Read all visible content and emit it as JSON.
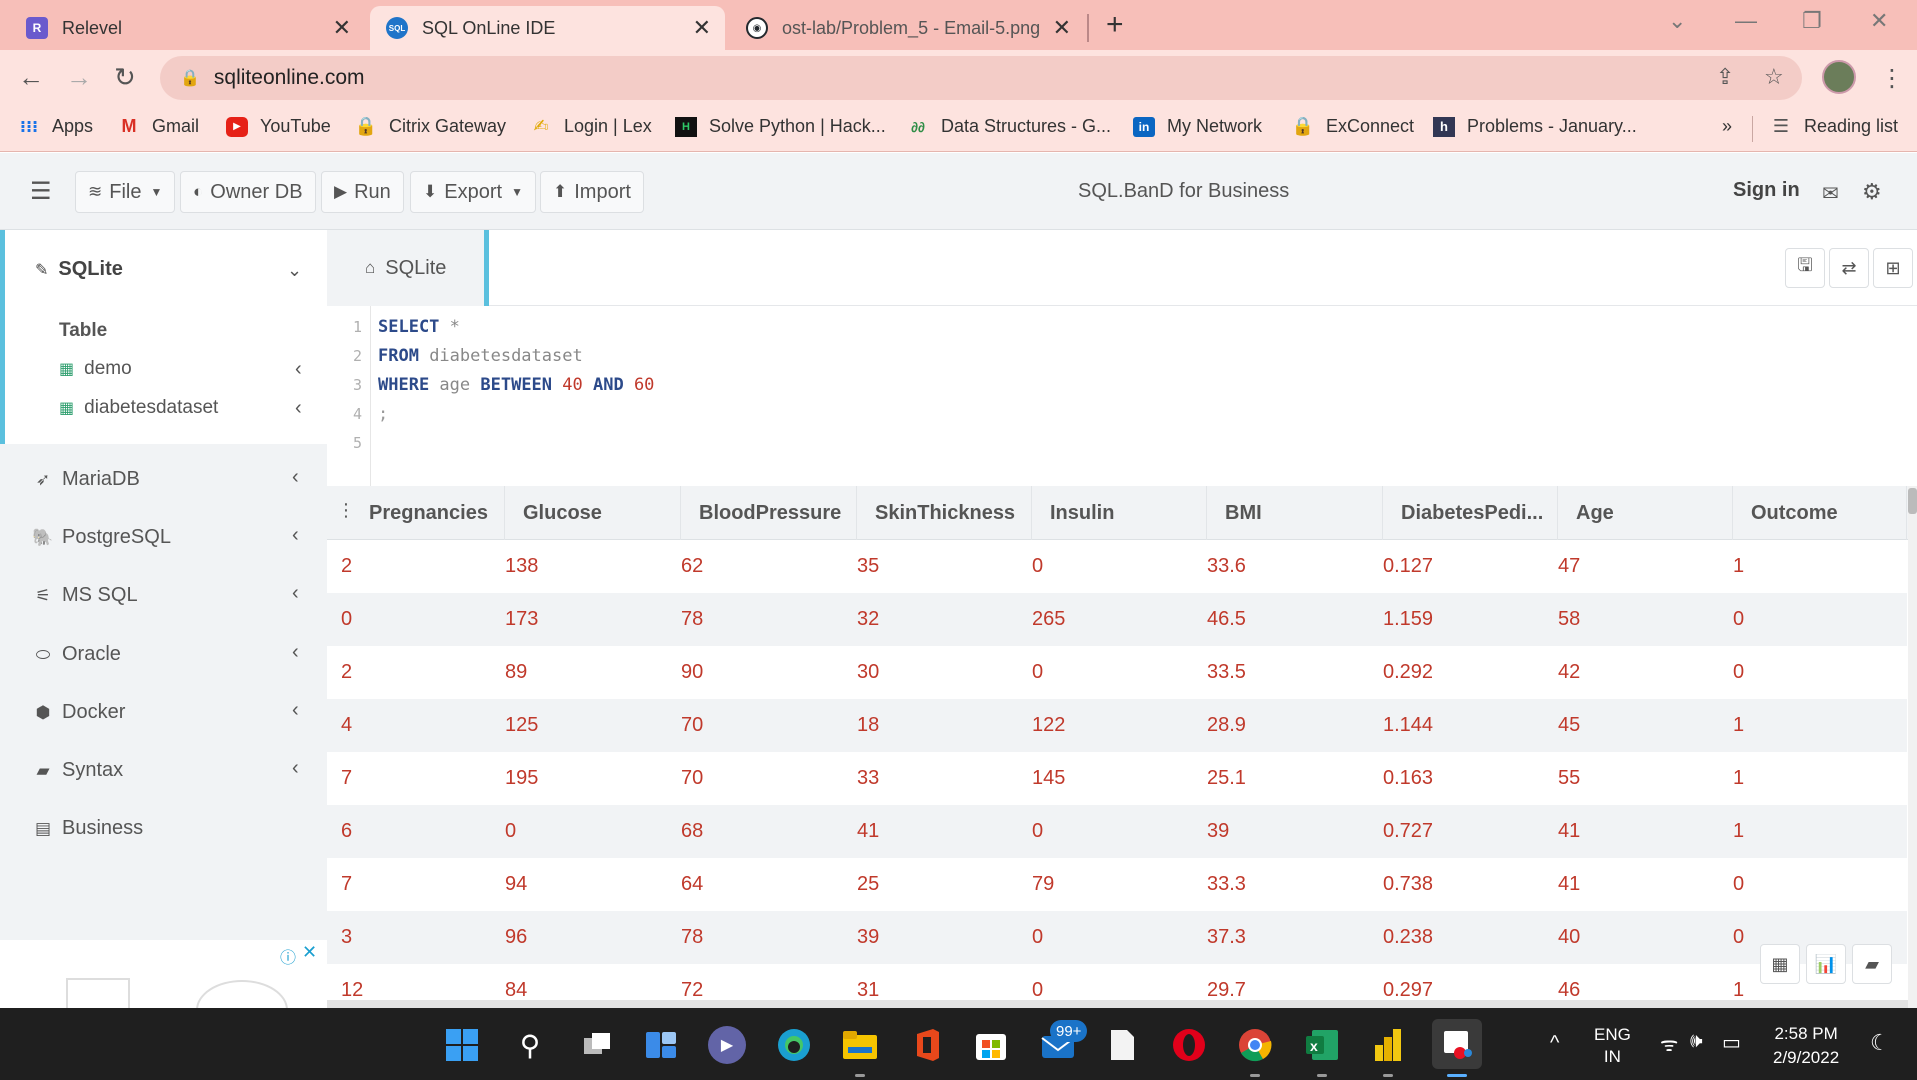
{
  "browser": {
    "tabs": [
      {
        "title": "Relevel",
        "icon": "relevel-icon",
        "color": "#6a5acd",
        "glyph": "R"
      },
      {
        "title": "SQL OnLine IDE",
        "icon": "sql-icon",
        "color": "#1f74c9",
        "glyph": "SQL"
      },
      {
        "title": "ost-lab/Problem_5 - Email-5.png",
        "icon": "github-icon",
        "color": "#24292e",
        "glyph": "◉"
      }
    ],
    "url": "sqliteonline.com",
    "bookmarks": [
      {
        "label": "Apps",
        "icon": "apps-grid-icon"
      },
      {
        "label": "Gmail",
        "icon": "gmail-icon"
      },
      {
        "label": "YouTube",
        "icon": "youtube-icon"
      },
      {
        "label": "Citrix Gateway",
        "icon": "citrix-icon"
      },
      {
        "label": "Login | Lex",
        "icon": "lex-icon"
      },
      {
        "label": "Solve Python | Hack...",
        "icon": "hackerrank-icon"
      },
      {
        "label": "Data Structures - G...",
        "icon": "geeks-icon"
      },
      {
        "label": "My Network",
        "icon": "linkedin-icon"
      },
      {
        "label": "ExConnect",
        "icon": "exconnect-icon"
      },
      {
        "label": "Problems - January...",
        "icon": "hackerearth-icon"
      }
    ],
    "reading_list": "Reading list",
    "more": "»"
  },
  "app": {
    "menu": {
      "file": "File",
      "owner_db": "Owner DB",
      "run": "Run",
      "export": "Export",
      "import": "Import"
    },
    "title": "SQL.BanD for Business",
    "sign_in": "Sign in"
  },
  "sidebar": {
    "sqlite": "SQLite",
    "table_heading": "Table",
    "tables": [
      "demo",
      "diabetesdataset"
    ],
    "databases": [
      {
        "label": "MariaDB",
        "icon": "mariadb-icon"
      },
      {
        "label": "PostgreSQL",
        "icon": "postgresql-icon"
      },
      {
        "label": "MS SQL",
        "icon": "mssql-icon"
      },
      {
        "label": "Oracle",
        "icon": "oracle-icon"
      },
      {
        "label": "Docker",
        "icon": "docker-icon"
      },
      {
        "label": "Syntax",
        "icon": "syntax-icon"
      },
      {
        "label": "Business",
        "icon": "business-icon"
      }
    ]
  },
  "editor": {
    "tab": "SQLite",
    "line_numbers": [
      "1",
      "2",
      "3",
      "4",
      "5"
    ],
    "code": {
      "l1_kw": "SELECT",
      "l1_rest": " *",
      "l2_kw": "FROM",
      "l2_id": " diabetesdataset",
      "l3_kw": "WHERE",
      "l3_id": " age ",
      "l3_kw2": "BETWEEN",
      "l3_n1": " 40 ",
      "l3_kw3": "AND",
      "l3_n2": " 60",
      "l4": ";"
    }
  },
  "results": {
    "columns": [
      "Pregnancies",
      "Glucose",
      "BloodPressure",
      "SkinThickness",
      "Insulin",
      "BMI",
      "DiabetesPedi...",
      "Age",
      "Outcome"
    ],
    "rows": [
      [
        "2",
        "138",
        "62",
        "35",
        "0",
        "33.6",
        "0.127",
        "47",
        "1"
      ],
      [
        "0",
        "173",
        "78",
        "32",
        "265",
        "46.5",
        "1.159",
        "58",
        "0"
      ],
      [
        "2",
        "89",
        "90",
        "30",
        "0",
        "33.5",
        "0.292",
        "42",
        "0"
      ],
      [
        "4",
        "125",
        "70",
        "18",
        "122",
        "28.9",
        "1.144",
        "45",
        "1"
      ],
      [
        "7",
        "195",
        "70",
        "33",
        "145",
        "25.1",
        "0.163",
        "55",
        "1"
      ],
      [
        "6",
        "0",
        "68",
        "41",
        "0",
        "39",
        "0.727",
        "41",
        "1"
      ],
      [
        "7",
        "94",
        "64",
        "25",
        "79",
        "33.3",
        "0.738",
        "41",
        "0"
      ],
      [
        "3",
        "96",
        "78",
        "39",
        "0",
        "37.3",
        "0.238",
        "40",
        "0"
      ],
      [
        "12",
        "84",
        "72",
        "31",
        "0",
        "29.7",
        "0.297",
        "46",
        "1"
      ]
    ]
  },
  "taskbar": {
    "mail_badge": "99+",
    "lang": "ENG",
    "region": "IN",
    "time": "2:58 PM",
    "date": "2/9/2022"
  }
}
